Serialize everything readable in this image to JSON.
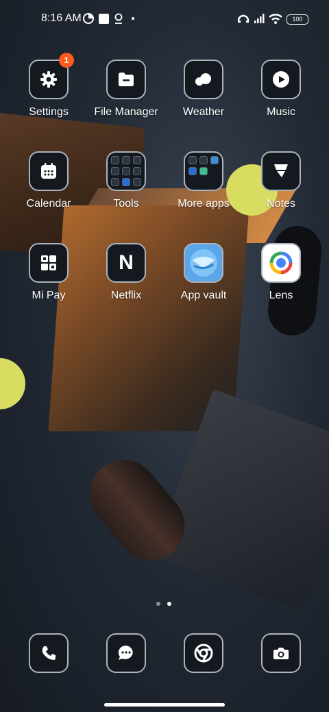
{
  "status_bar": {
    "time": "8:16 AM",
    "battery": "100"
  },
  "apps": [
    {
      "label": "Settings",
      "badge": "1"
    },
    {
      "label": "File Manager"
    },
    {
      "label": "Weather"
    },
    {
      "label": "Music"
    },
    {
      "label": "Calendar"
    },
    {
      "label": "Tools"
    },
    {
      "label": "More apps"
    },
    {
      "label": "Notes"
    },
    {
      "label": "Mi Pay"
    },
    {
      "label": "Netflix"
    },
    {
      "label": "App vault"
    },
    {
      "label": "Lens"
    }
  ],
  "netflix_glyph": "N",
  "dock": [
    "Phone",
    "Messages",
    "Chrome",
    "Camera"
  ],
  "page_indicator": {
    "pages": 2,
    "current": 2
  },
  "colors": {
    "badge": "#ff5a1f",
    "accent_yellow": "#d8dd62",
    "icon_border": "#aeb4bd"
  }
}
